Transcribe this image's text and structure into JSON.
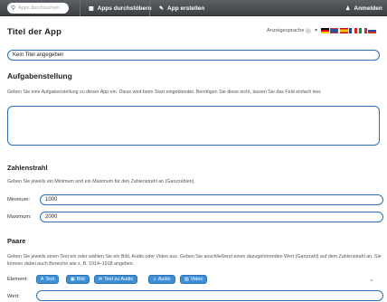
{
  "topbar": {
    "search_placeholder": "Apps durchsuchen",
    "browse_label": "Apps durchstöbern",
    "create_label": "App erstellen",
    "login_label": "Anmelden"
  },
  "header": {
    "title": "Titel der App",
    "lang_label": "Anzeigesprache"
  },
  "title_input": {
    "value": "Kein Titel angegeben"
  },
  "task": {
    "heading": "Aufgabenstellung",
    "description": "Geben Sie eine Aufgabenstellung zu dieser App ein. Diese wird beim Start eingeblendet. Benötigen Sie diese nicht, lassen Sie das Feld einfach leer.",
    "value": ""
  },
  "numberline": {
    "heading": "Zahlenstrahl",
    "description": "Geben Sie jeweils ein Minimum und ein Maximum für den Zahlenstrahl an (Ganzzahlen).",
    "min_label": "Minimum:",
    "min_value": "1000",
    "max_label": "Maximum:",
    "max_value": "2000"
  },
  "pairs": {
    "heading": "Paare",
    "description": "Geben Sie jeweils einen Text ein oder wählen Sie ein Bild, Audio oder Video aus. Geben Sie anschließend einen dazugehörenden Wert (Ganzzahl) auf dem Zahlenstrahl an. Sie können dabei auch Bereiche wie z. B. 1914–1918 angeben.",
    "element_label": "Element:",
    "value_label": "Wert:",
    "buttons": [
      "Text",
      "Bild",
      "Text zu Audio",
      "Audio",
      "Video"
    ]
  },
  "colors": {
    "accent": "#3f8fd6",
    "input_border": "#2a70b8",
    "topbar": "#4a4e52"
  },
  "icons": [
    "search-icon",
    "grid-icon",
    "pencil-icon",
    "user-icon",
    "help-icon",
    "chevron-down-icon"
  ]
}
